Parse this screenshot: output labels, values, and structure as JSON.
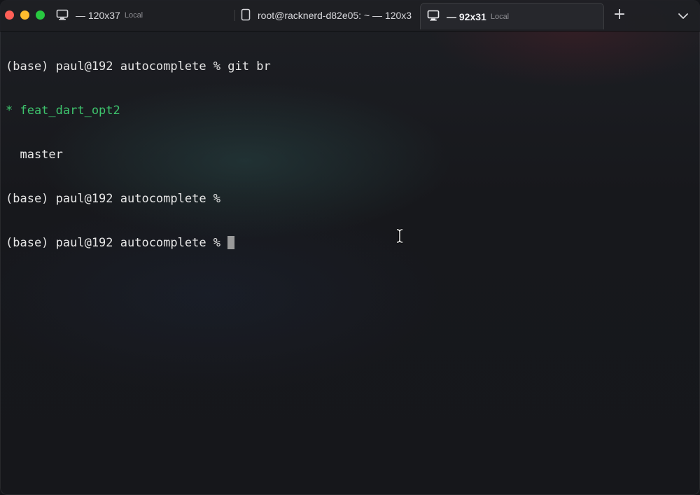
{
  "tabs": [
    {
      "title": "— 120x37",
      "subtitle": "Local",
      "icon": "monitor-icon",
      "active": false
    },
    {
      "title": "root@racknerd-d82e05: ~ — 120x3",
      "subtitle": "",
      "icon": "tablet-icon",
      "active": false
    },
    {
      "title": "— 92x31",
      "subtitle": "Local",
      "icon": "monitor-icon",
      "active": true
    }
  ],
  "toolbar": {
    "new_tab": "+",
    "tab_overview_icon": "chevron-down-icon"
  },
  "terminal": {
    "lines": [
      "(base) paul@192 autocomplete % git br",
      "* feat_dart_opt2",
      "  master",
      "(base) paul@192 autocomplete %",
      "(base) paul@192 autocomplete % "
    ]
  },
  "colors": {
    "background": "#17181c",
    "text": "#e6e6e6",
    "current_branch": "#3ec46d",
    "cursor": "#9a9a9a",
    "close": "#ff5f57",
    "minimize": "#febc2e",
    "maximize": "#28c840"
  }
}
